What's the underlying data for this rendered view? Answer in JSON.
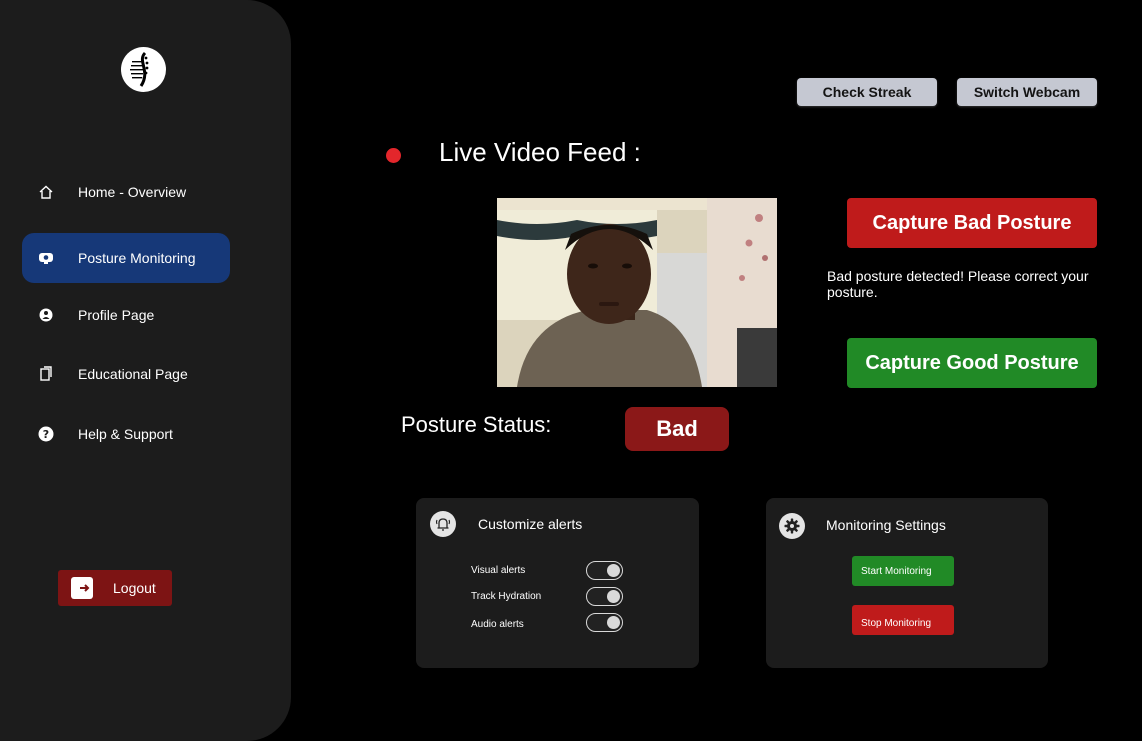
{
  "sidebar": {
    "logo_icon": "spine-logo",
    "items": [
      {
        "label": "Home - Overview",
        "icon": "home-icon"
      },
      {
        "label": "Posture Monitoring",
        "icon": "webcam-icon"
      },
      {
        "label": "Profile Page",
        "icon": "user-circle-icon"
      },
      {
        "label": "Educational Page",
        "icon": "document-icon"
      },
      {
        "label": "Help & Support",
        "icon": "question-icon"
      }
    ],
    "active_item": "Posture Monitoring",
    "logout_label": "Logout"
  },
  "header": {
    "check_streak_label": "Check Streak",
    "switch_webcam_label": "Switch Webcam"
  },
  "feed": {
    "title": "Live Video Feed :",
    "capture_bad_label": "Capture Bad Posture",
    "capture_good_label": "Capture Good Posture",
    "warning_text": "Bad posture detected! Please correct your posture."
  },
  "status": {
    "label": "Posture Status:",
    "value": "Bad"
  },
  "alerts": {
    "title": "Customize alerts",
    "toggles": [
      {
        "label": "Visual alerts",
        "on": true
      },
      {
        "label": "Track Hydration",
        "on": true
      },
      {
        "label": "Audio alerts",
        "on": true
      }
    ]
  },
  "monitoring": {
    "title": "Monitoring Settings",
    "start_label": "Start Monitoring",
    "stop_label": "Stop Monitoring"
  },
  "colors": {
    "sidebar_bg": "#1c1c1c",
    "active_nav": "#163878",
    "danger": "#bf1b1b",
    "success": "#218a26",
    "status_bad": "#8b1818"
  }
}
